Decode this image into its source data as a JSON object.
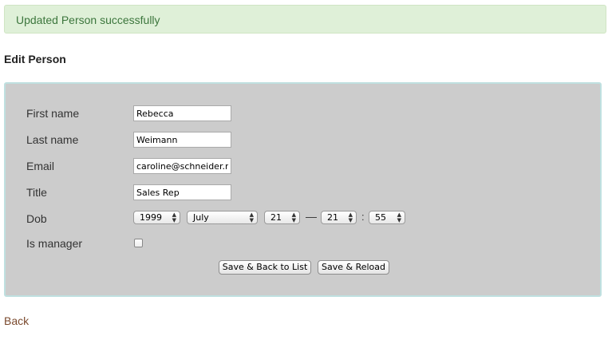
{
  "flash": {
    "message": "Updated Person successfully",
    "color": "#3c763d",
    "background": "#dff0d8"
  },
  "page": {
    "title": "Edit Person"
  },
  "form": {
    "first_name": {
      "label": "First name",
      "value": "Rebecca"
    },
    "last_name": {
      "label": "Last name",
      "value": "Weimann"
    },
    "email": {
      "label": "Email",
      "value": "caroline@schneider.na"
    },
    "title": {
      "label": "Title",
      "value": "Sales Rep"
    },
    "dob": {
      "label": "Dob",
      "year": "1999",
      "month": "July",
      "day": "21",
      "hour": "21",
      "minute": "55",
      "date_time_separator": "—",
      "time_separator": ":"
    },
    "is_manager": {
      "label": "Is manager",
      "checked": false
    },
    "buttons": {
      "save_back": "Save & Back to List",
      "save_reload": "Save & Reload"
    }
  },
  "back_link": "Back",
  "icons": {
    "select_arrows": "up-down-chevron-icon"
  },
  "colors": {
    "panel_background": "#cccccc",
    "panel_border": "#bfe0e0",
    "link": "#7b4a2e"
  }
}
